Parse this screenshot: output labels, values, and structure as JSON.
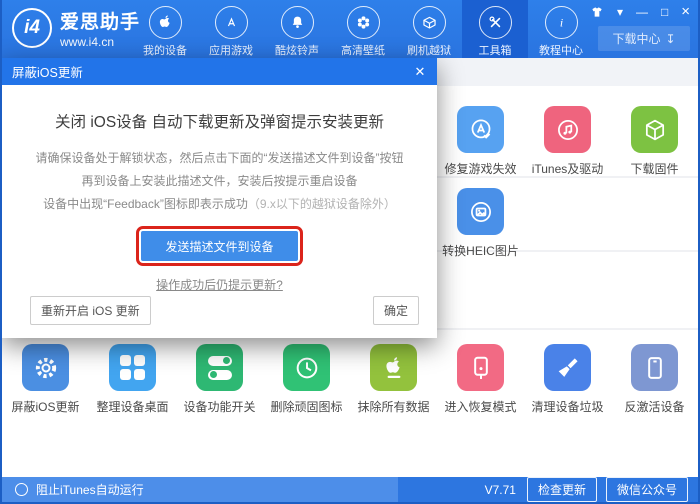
{
  "header": {
    "logo": {
      "badge": "i4",
      "name": "爱思助手",
      "site": "www.i4.cn"
    },
    "nav": [
      {
        "label": "我的设备",
        "icon": "apple-icon",
        "active": false
      },
      {
        "label": "应用游戏",
        "icon": "appstore-icon",
        "active": false
      },
      {
        "label": "酷炫铃声",
        "icon": "bell-icon",
        "active": false
      },
      {
        "label": "高清壁纸",
        "icon": "flower-icon",
        "active": false
      },
      {
        "label": "刷机越狱",
        "icon": "jailbreak-box-icon",
        "active": false
      },
      {
        "label": "工具箱",
        "icon": "tools-icon",
        "active": true
      },
      {
        "label": "教程中心",
        "icon": "info-icon",
        "active": false
      }
    ],
    "download_center": {
      "label": "下载中心",
      "icon": "download-icon"
    }
  },
  "modal": {
    "title": "屏蔽iOS更新",
    "heading": "关闭 iOS设备 自动下载更新及弹窗提示安装更新",
    "line1": "请确保设备处于解锁状态，然后点击下面的“发送描述文件到设备”按钮",
    "line2": "再到设备上安装此描述文件，安装后按提示重启设备",
    "line3": "设备中出现“Feedback”图标即表示成功",
    "line3_note": "（9.x以下的越狱设备除外）",
    "primary_button": "发送描述文件到设备",
    "link": "操作成功后仍提示更新?",
    "reset_button": "重新开启 iOS 更新",
    "confirm_button": "确定",
    "accent_color": "#3f8de9",
    "annotation_color": "#db241b"
  },
  "tools": {
    "row1": [
      {
        "label": "修复游戏失效",
        "icon": "appstore-fix-icon",
        "color": "#57a2f1"
      },
      {
        "label": "iTunes及驱动",
        "icon": "itunes-music-icon",
        "color": "#ef647e"
      },
      {
        "label": "下载固件",
        "icon": "firmware-cube-icon",
        "color": "#7dc242"
      }
    ],
    "row2": [
      {
        "label": "转换HEIC图片",
        "icon": "heic-photo-icon",
        "color": "#4a90e8"
      }
    ],
    "row3": [
      {
        "label": "屏蔽iOS更新",
        "icon": "gear-icon",
        "color": "#4b8fe2"
      },
      {
        "label": "整理设备桌面",
        "icon": "grid-icon",
        "color": "#42a5f0"
      },
      {
        "label": "设备功能开关",
        "icon": "toggles-icon",
        "color": "#2eb873"
      },
      {
        "label": "删除顽固图标",
        "icon": "clock-icon",
        "color": "#30c275"
      },
      {
        "label": "抹除所有数据",
        "icon": "apple-erase-icon",
        "color": "#93c23d"
      },
      {
        "label": "进入恢复模式",
        "icon": "phone-recovery-icon",
        "color": "#f26a84"
      },
      {
        "label": "清理设备垃圾",
        "icon": "broom-icon",
        "color": "#4a82e8"
      },
      {
        "label": "反激活设备",
        "icon": "phone-deactivate-icon",
        "color": "#7e97d2"
      }
    ]
  },
  "statusbar": {
    "checkbox_label": "阻止iTunes自动运行",
    "version": "V7.71",
    "check_update_button": "检查更新",
    "wechat_button": "微信公众号"
  }
}
